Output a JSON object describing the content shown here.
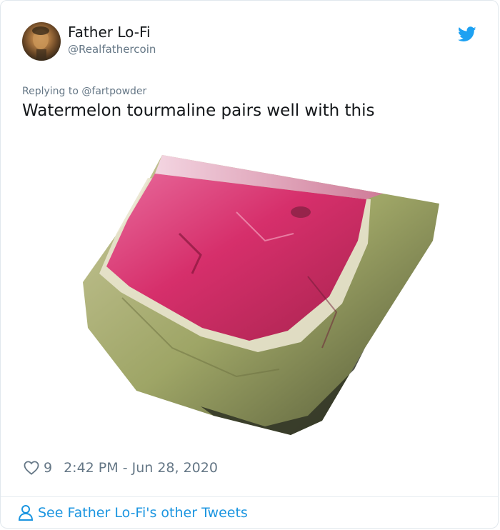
{
  "author": {
    "name": "Father Lo-Fi",
    "handle": "@Realfathercoin",
    "avatar_icon": "user-avatar"
  },
  "reply": {
    "prefix": "Replying to ",
    "mention": "@fartpowder"
  },
  "tweet": {
    "text": "Watermelon tourmaline pairs well with this",
    "media_description": "watermelon tourmaline gemstone"
  },
  "stats": {
    "likes": "9",
    "timestamp": "2:42 PM - Jun 28, 2020"
  },
  "footer": {
    "link_text": "See Father Lo-Fi's other Tweets"
  },
  "colors": {
    "accent": "#1da1f2",
    "text": "#14171a",
    "secondary": "#657786",
    "link": "#1b95e0"
  }
}
